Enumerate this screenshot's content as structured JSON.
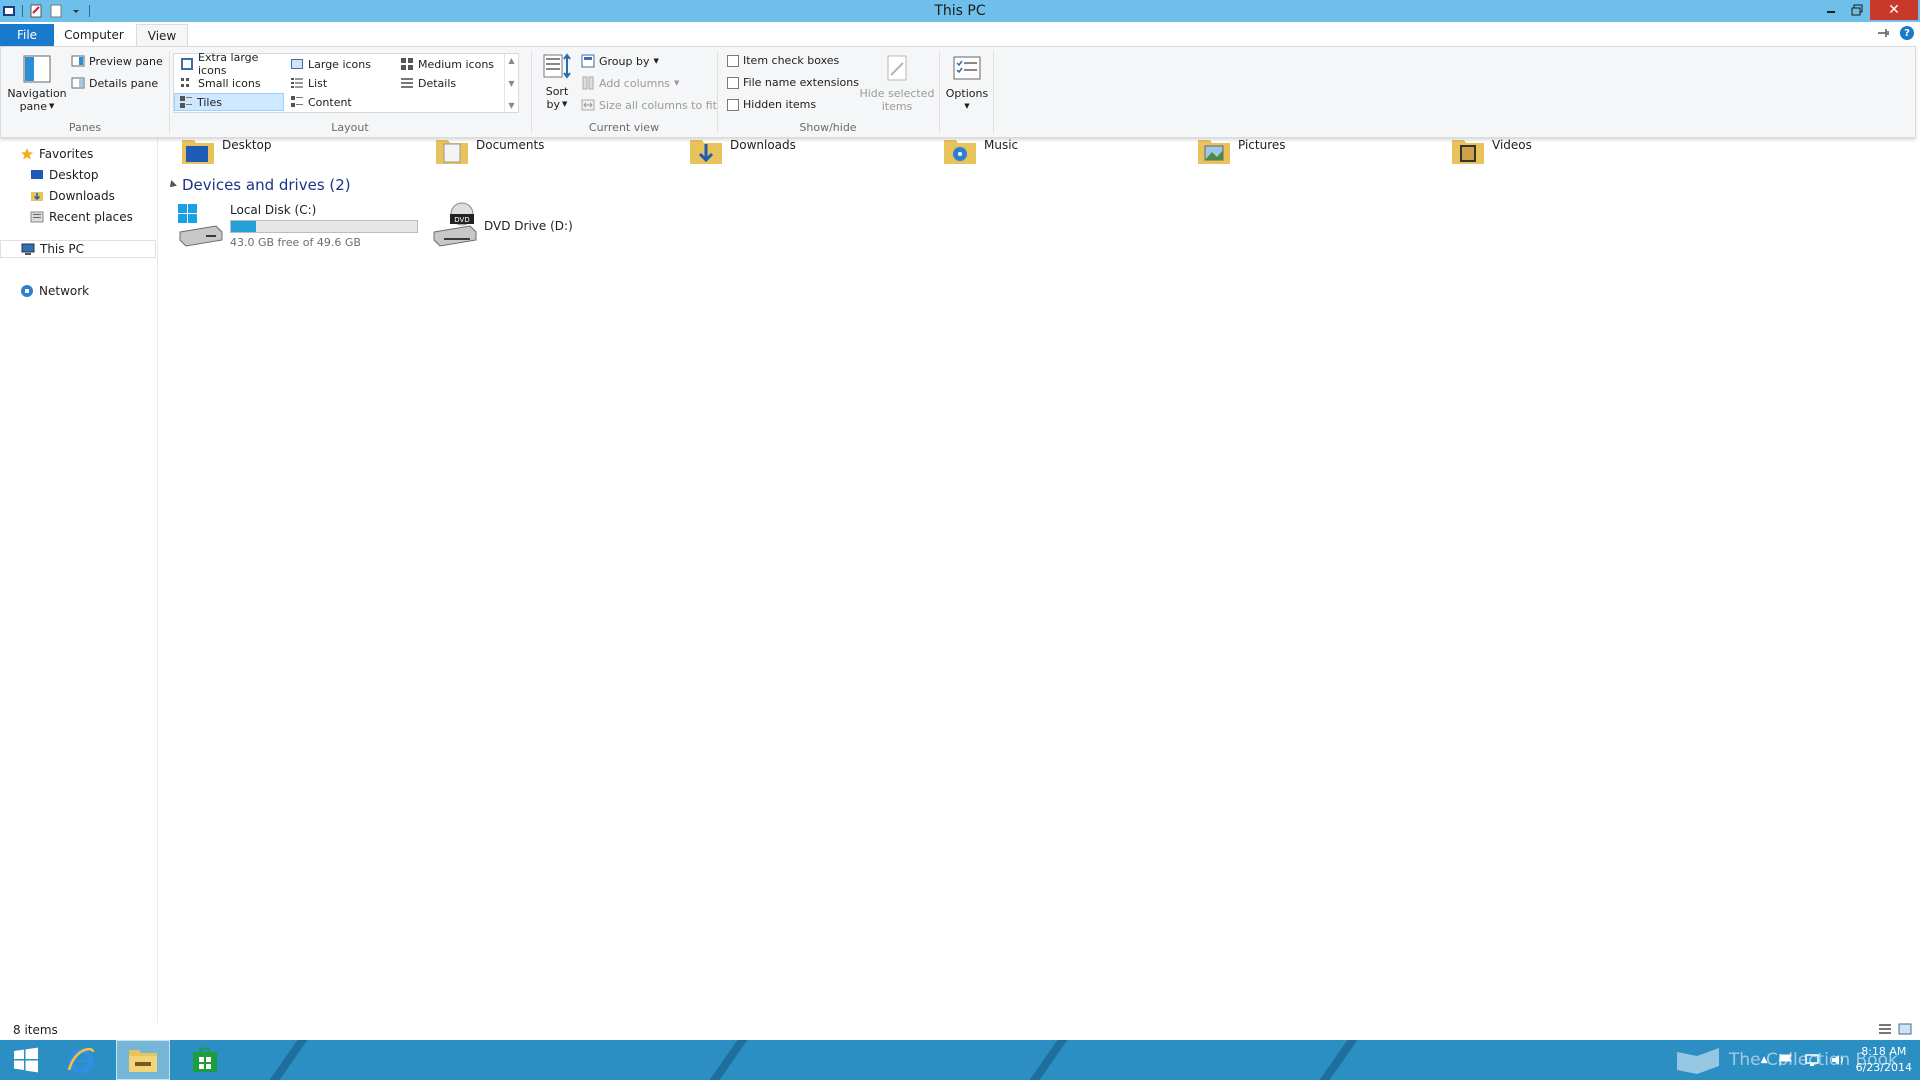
{
  "window": {
    "title": "This PC"
  },
  "tabs": {
    "file": "File",
    "computer": "Computer",
    "view": "View"
  },
  "ribbon": {
    "panes": {
      "label": "Panes",
      "navigation_pane_line1": "Navigation",
      "navigation_pane_line2": "pane",
      "preview_pane": "Preview pane",
      "details_pane": "Details pane"
    },
    "layout": {
      "label": "Layout",
      "items": {
        "extra_large": "Extra large icons",
        "large": "Large icons",
        "medium": "Medium icons",
        "small": "Small icons",
        "list": "List",
        "details": "Details",
        "tiles": "Tiles",
        "content": "Content"
      },
      "selected": "Tiles"
    },
    "current_view": {
      "label": "Current view",
      "sort_line1": "Sort",
      "sort_line2": "by",
      "group_by": "Group by",
      "add_columns": "Add columns",
      "size_columns": "Size all columns to fit"
    },
    "show_hide": {
      "label": "Show/hide",
      "item_check_boxes": "Item check boxes",
      "file_name_extensions": "File name extensions",
      "hidden_items": "Hidden items",
      "hide_selected_line1": "Hide selected",
      "hide_selected_line2": "items"
    },
    "options": {
      "label": "Options"
    }
  },
  "nav": {
    "favorites": "Favorites",
    "desktop": "Desktop",
    "downloads": "Downloads",
    "recent_places": "Recent places",
    "this_pc": "This PC",
    "network": "Network"
  },
  "folders": [
    "Desktop",
    "Documents",
    "Downloads",
    "Music",
    "Pictures",
    "Videos"
  ],
  "devices": {
    "header": "Devices and drives (2)",
    "local_disk": {
      "name": "Local Disk (C:)",
      "free_text": "43.0 GB free of 49.6 GB",
      "used_fraction": 0.133
    },
    "dvd": {
      "name": "DVD Drive (D:)",
      "badge": "DVD"
    }
  },
  "status": {
    "count": "8 items"
  },
  "taskbar": {
    "watermark": "The Collection Book",
    "time": "8:18 AM",
    "date": "6/23/2014"
  },
  "colors": {
    "titlebar": "#6ec0ea",
    "file_tab": "#1979ca",
    "taskbar": "#2c8fc4",
    "usage_fill": "#26a0da",
    "close": "#c9392b"
  }
}
